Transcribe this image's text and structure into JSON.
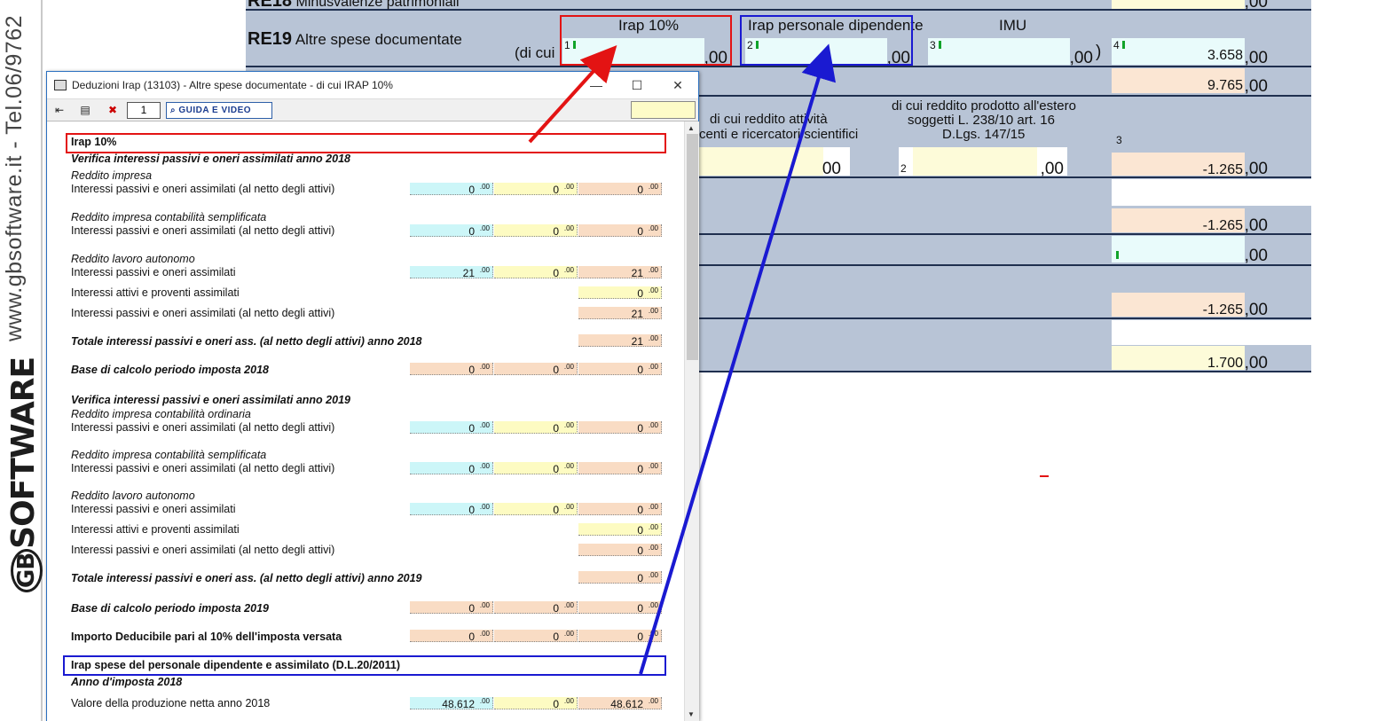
{
  "brand": {
    "url_text": "www.gbsoftware.it - Tel.06/9762",
    "logo_text": "SOFTWARE",
    "logo_prefix": "GB"
  },
  "form": {
    "partial_row_label": "Minusvalenze patrimoniali",
    "partial_row_value": "",
    "partial_row_dec": ",00",
    "re19_code": "RE19",
    "re19_label": "Altre spese documentate",
    "di_cui": "(di cui",
    "close_paren": ")",
    "col_headers": [
      "Irap 10%",
      "Irap personale dipendente",
      "IMU"
    ],
    "field_numbers": [
      "1",
      "2",
      "3",
      "4"
    ],
    "re19_values": [
      "",
      "",
      "",
      "3.658"
    ],
    "dec_00": ",00",
    "dec_00_short": "00",
    "row_total_value": "9.765",
    "di_cui_reddito_attivita": "di cui reddito attività",
    "docenti_ricercatori": "centi e ricercatori scientifici",
    "di_cui_estero_l1": "di cui reddito prodotto all'estero",
    "di_cui_estero_l2": "soggetti L. 238/10 art. 16",
    "di_cui_estero_l3": "D.Lgs. 147/15",
    "field3_label": "3",
    "field2_label": "2",
    "values_col": [
      "-1.265",
      "-1.265",
      "",
      "-1.265",
      "1.700"
    ]
  },
  "window": {
    "title": "Deduzioni Irap (13103) - Altre spese documentate - di cui IRAP 10%",
    "ctrl_min": "—",
    "ctrl_max": "☐",
    "ctrl_close": "✕",
    "page_number": "1",
    "guide_label": "GUIDA E VIDEO"
  },
  "content": {
    "section1_title": "Irap 10%",
    "verifica_2018": "Verifica interessi passivi e oneri assimilati anno 2018",
    "reddito_impresa": "Reddito impresa",
    "interessi_netto": "Interessi passivi e oneri assimilati (al netto degli attivi)",
    "reddito_semplificata": "Reddito impresa contabilità semplificata",
    "reddito_lavoro": "Reddito lavoro autonomo",
    "interessi_passivi": "Interessi passivi e oneri assimilati",
    "interessi_attivi": "Interessi attivi e proventi assimilati",
    "totale_2018": "Totale interessi passivi e oneri ass. (al netto degli attivi) anno 2018",
    "base_2018": "Base di calcolo periodo imposta 2018",
    "verifica_2019": "Verifica interessi passivi e oneri assimilati anno 2019",
    "reddito_ordinaria": "Reddito impresa contabilità ordinaria",
    "totale_2019": "Totale interessi passivi e oneri ass. (al netto degli attivi) anno 2019",
    "base_2019": "Base di calcolo periodo imposta 2019",
    "importo_deducibile": "Importo Deducibile pari al 10% dell'imposta versata",
    "section2_title": "Irap spese del personale dipendente e assimilato (D.L.20/2011)",
    "anno_2018": "Anno d'imposta 2018",
    "valore_produzione": "Valore della produzione netta anno 2018",
    "dec": ".00",
    "v": {
      "r1": [
        "0",
        "0",
        "0"
      ],
      "r2": [
        "0",
        "0",
        "0"
      ],
      "r3": [
        "21",
        "0",
        "21"
      ],
      "r4": "0",
      "r5": "21",
      "r6": "21",
      "r7": [
        "0",
        "0",
        "0"
      ],
      "r8": [
        "0",
        "0",
        "0"
      ],
      "r9": [
        "0",
        "0",
        "0"
      ],
      "r10": [
        "0",
        "0",
        "0"
      ],
      "r11": "0",
      "r12": "0",
      "r13": "0",
      "r14": [
        "0",
        "0",
        "0"
      ],
      "r15": [
        "0",
        "0",
        "0"
      ],
      "r16": [
        "48.612",
        "0",
        "48.612"
      ]
    }
  },
  "colors": {
    "annotation_red": "#e31313",
    "annotation_blue": "#1a1ad1",
    "form_background": "#b8c4d6",
    "cell_cyan": "#ccf6f8",
    "cell_yellow": "#fdfbc2",
    "cell_peach": "#f9dcc4"
  }
}
